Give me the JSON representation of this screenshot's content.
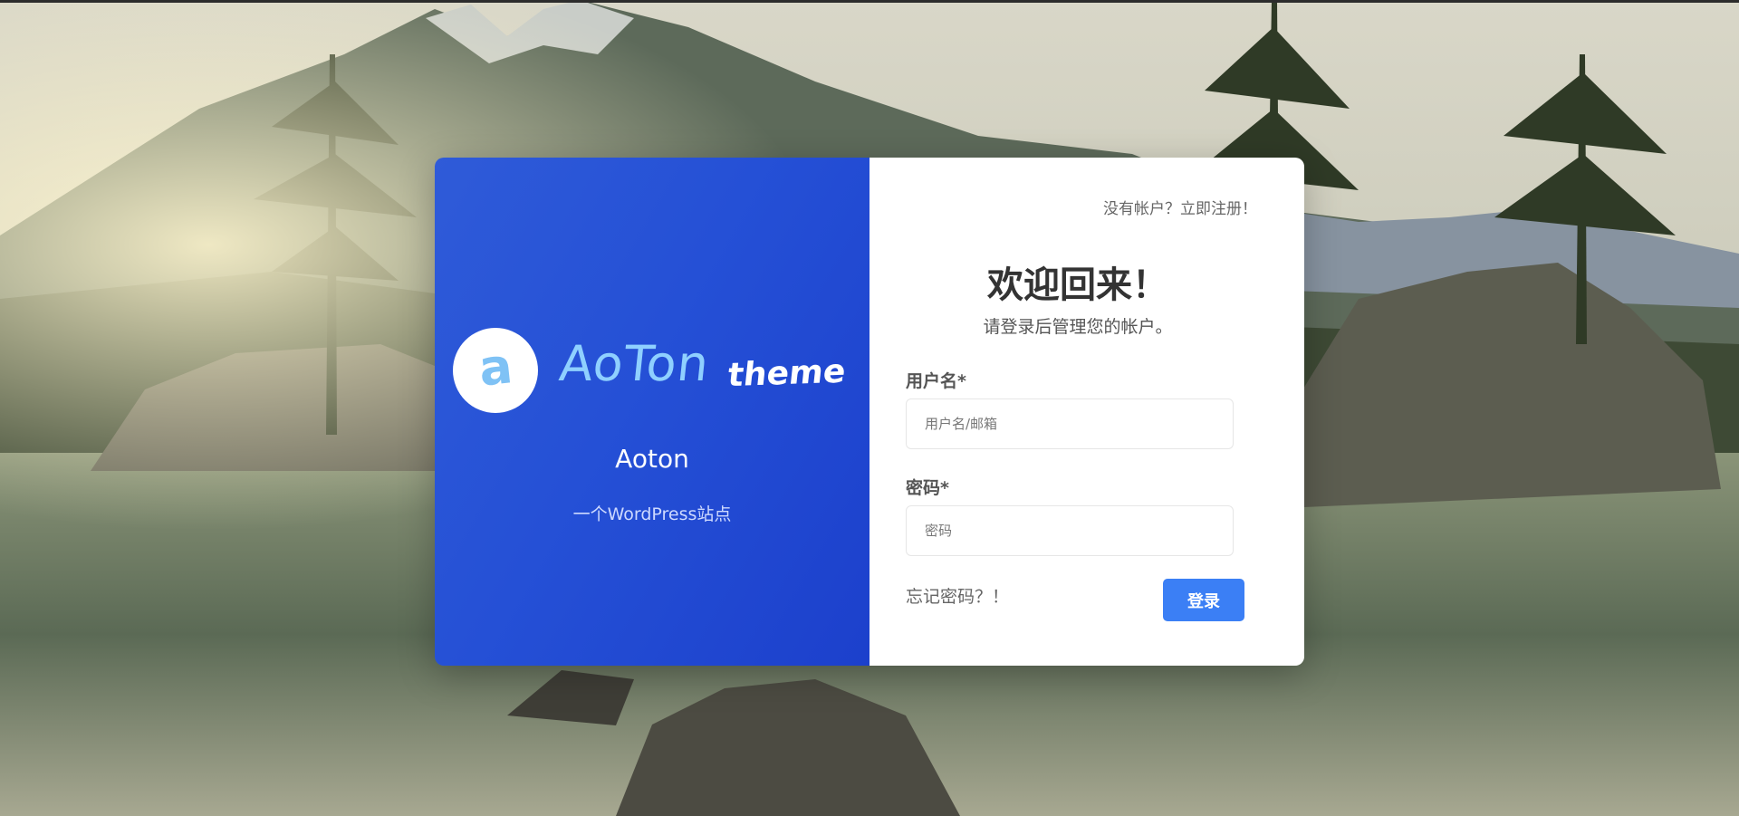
{
  "brand": {
    "logo_letter": "a",
    "logo_word": "AoTon",
    "logo_theme": "theme",
    "site_name": "Aoton",
    "site_description": "一个WordPress站点"
  },
  "login": {
    "register_prompt": "没有帐户？立即注册！",
    "welcome_title": "欢迎回来！",
    "subtitle": "请登录后管理您的帐户。",
    "username_label": "用户名*",
    "username_placeholder": "用户名/邮箱",
    "password_label": "密码*",
    "password_placeholder": "密码",
    "forgot_link": "忘记密码？！",
    "submit_label": "登录"
  },
  "colors": {
    "panel_blue": "#2550d6",
    "logo_blue": "#8fd0ff",
    "button_blue": "#3b7ff5",
    "card_white": "#ffffff"
  }
}
